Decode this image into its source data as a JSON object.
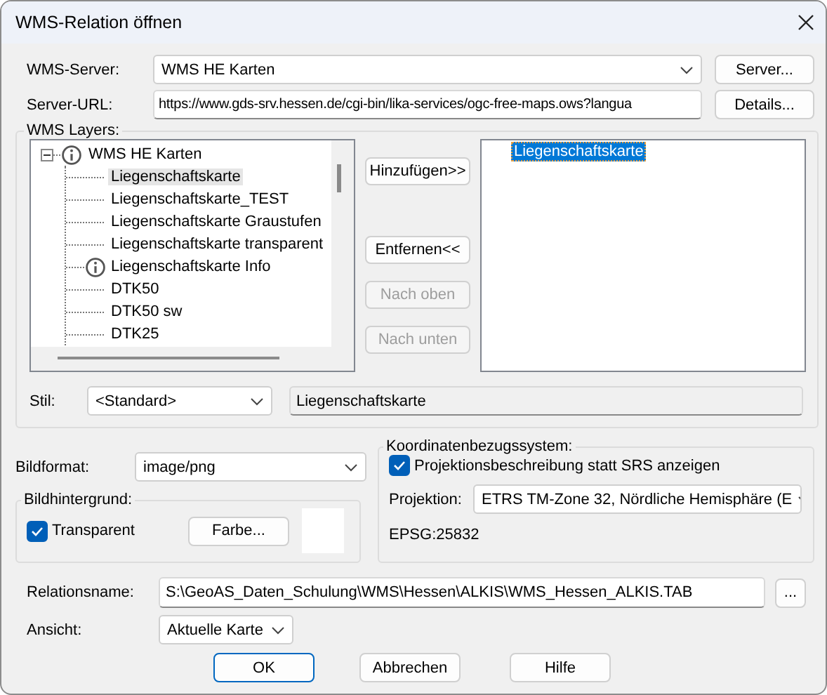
{
  "window": {
    "title": "WMS-Relation öffnen"
  },
  "server": {
    "label": "WMS-Server:",
    "value": "WMS HE Karten",
    "button": "Server..."
  },
  "url": {
    "label": "Server-URL:",
    "value": "https://www.gds-srv.hessen.de/cgi-bin/lika-services/ogc-free-maps.ows?langua",
    "button": "Details..."
  },
  "layers": {
    "title": "WMS Layers:",
    "tree": {
      "label": "WMS HE Karten",
      "expanded": true,
      "children": [
        {
          "label": "Liegenschaftskarte",
          "selected": true,
          "info": false
        },
        {
          "label": "Liegenschaftskarte_TEST",
          "selected": false,
          "info": false
        },
        {
          "label": "Liegenschaftskarte Graustufen",
          "selected": false,
          "info": false
        },
        {
          "label": "Liegenschaftskarte transparent",
          "selected": false,
          "info": false
        },
        {
          "label": "Liegenschaftskarte Info",
          "selected": false,
          "info": true
        },
        {
          "label": "DTK50",
          "selected": false,
          "info": false
        },
        {
          "label": "DTK50 sw",
          "selected": false,
          "info": false
        },
        {
          "label": "DTK25",
          "selected": false,
          "info": false
        }
      ]
    },
    "buttons": [
      {
        "label": "Hinzufügen>>",
        "disabled": false
      },
      {
        "label": "Entfernen<<",
        "disabled": false
      },
      {
        "label": "Nach oben",
        "disabled": true
      },
      {
        "label": "Nach unten",
        "disabled": true
      }
    ],
    "chosen": [
      {
        "label": "Liegenschaftskarte",
        "selected": true
      }
    ],
    "style": {
      "label": "Stil:",
      "value": "<Standard>",
      "name": "Liegenschaftskarte"
    }
  },
  "format": {
    "label": "Bildformat:",
    "value": "image/png"
  },
  "background": {
    "title": "Bildhintergrund:",
    "transparent": {
      "label": "Transparent",
      "checked": true
    },
    "button": "Farbe..."
  },
  "crs": {
    "title": "Koordinatenbezugssystem:",
    "describe": {
      "label": "Projektionsbeschreibung statt SRS anzeigen",
      "checked": true
    },
    "projection_label": "Projektion:",
    "projection": "ETRS TM-Zone 32, Nördliche Hemisphäre (E",
    "epsg": "EPSG:25832"
  },
  "relation": {
    "label": "Relationsname:",
    "value": "S:\\GeoAS_Daten_Schulung\\WMS\\Hessen\\ALKIS\\WMS_Hessen_ALKIS.TAB",
    "button": "..."
  },
  "view": {
    "label": "Ansicht:",
    "value": "Aktuelle Karte"
  },
  "buttons": [
    {
      "label": "OK",
      "primary": true
    },
    {
      "label": "Abbrechen",
      "primary": false
    },
    {
      "label": "Hilfe",
      "primary": false
    }
  ]
}
